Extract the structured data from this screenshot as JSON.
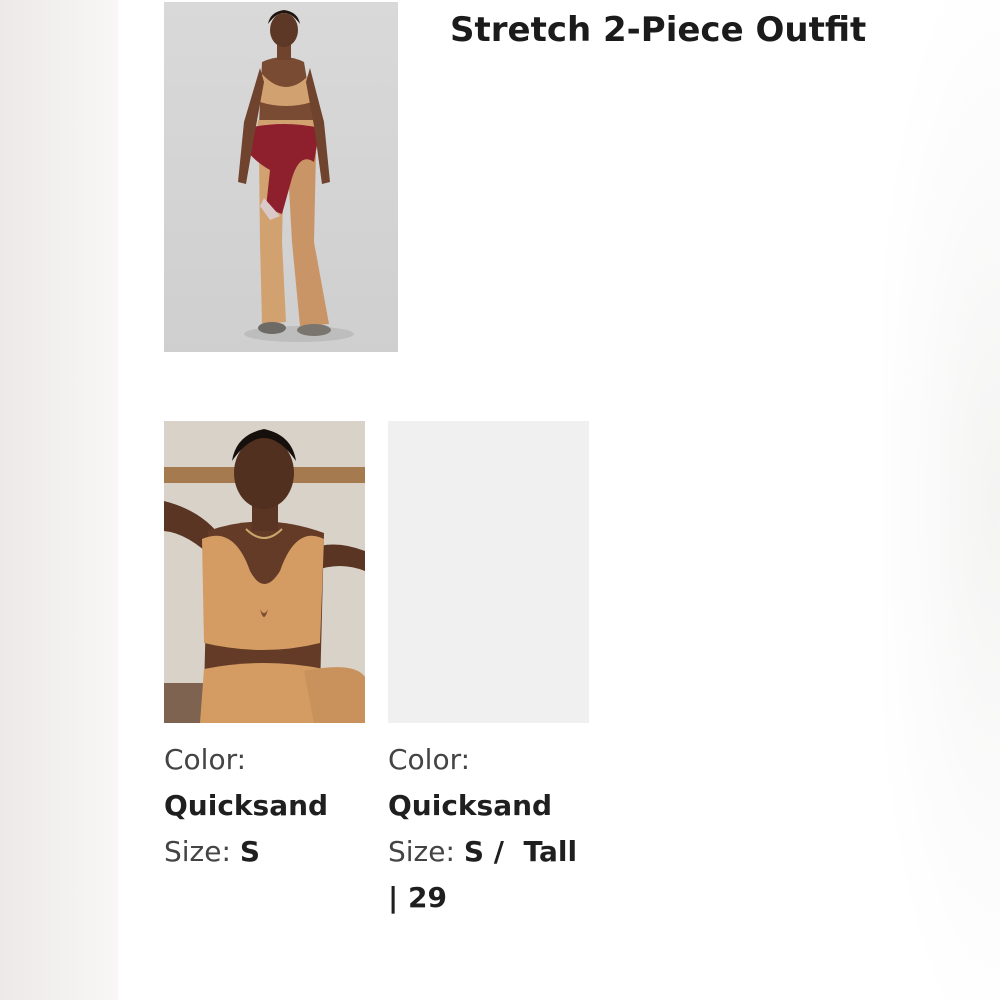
{
  "product": {
    "title": "Stretch 2-Piece Outfit"
  },
  "items": [
    {
      "color_label": "Color:",
      "color_value": "Quicksand",
      "size_label": "Size:",
      "size_value": "S"
    },
    {
      "color_label": "Color:",
      "color_value": "Quicksand",
      "size_label": "Size:",
      "size_value": "S /  Tall | 29"
    }
  ],
  "colors": {
    "outfit": "#d2a170",
    "jacket": "#8e1f2c",
    "backdrop": "#dcdcdc",
    "placeholder": "#f0f0f0"
  }
}
